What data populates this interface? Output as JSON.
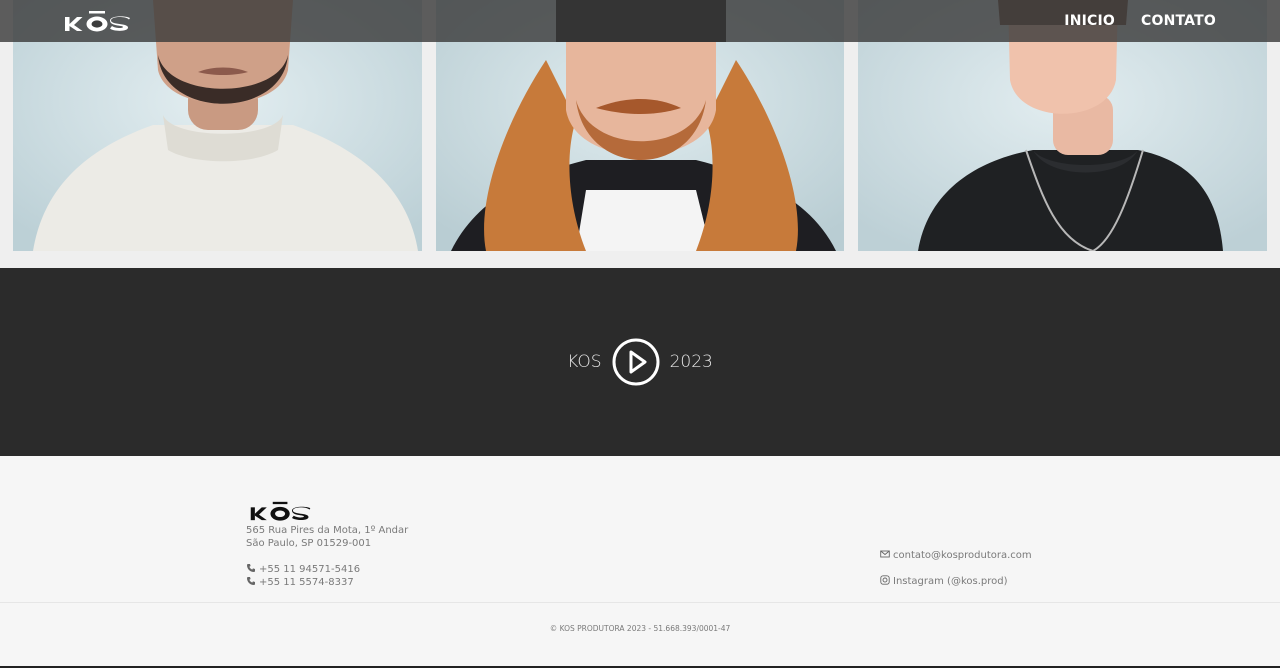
{
  "header": {
    "logo_text": "KŌS",
    "nav": [
      {
        "label": "INICIO"
      },
      {
        "label": "CONTATO"
      }
    ]
  },
  "photos": [
    {
      "icon": "portrait-man-white-sweater"
    },
    {
      "icon": "portrait-man-long-hair"
    },
    {
      "icon": "portrait-man-black-shirt-chain"
    }
  ],
  "video": {
    "left_text": "KOS",
    "right_text": "2023",
    "icon": "play-icon"
  },
  "footer": {
    "logo_text": "KŌS",
    "address_line1": "565 Rua Pires da Mota, 1º Andar",
    "address_line2": "São Paulo, SP 01529-001",
    "phone1": "+55 11 94571-5416",
    "phone2": "+55 11 5574-8337",
    "email": "contato@kosprodutora.com",
    "instagram": "Instagram (@kos.prod)",
    "copyright": "© KOS PRODUTORA 2023 - 51.668.393/0001-47"
  },
  "colors": {
    "header_bg": "#3c3c3c",
    "video_bg": "#2b2b2b",
    "footer_bg": "#f6f6f6",
    "footer_text": "#7a7a7a"
  }
}
